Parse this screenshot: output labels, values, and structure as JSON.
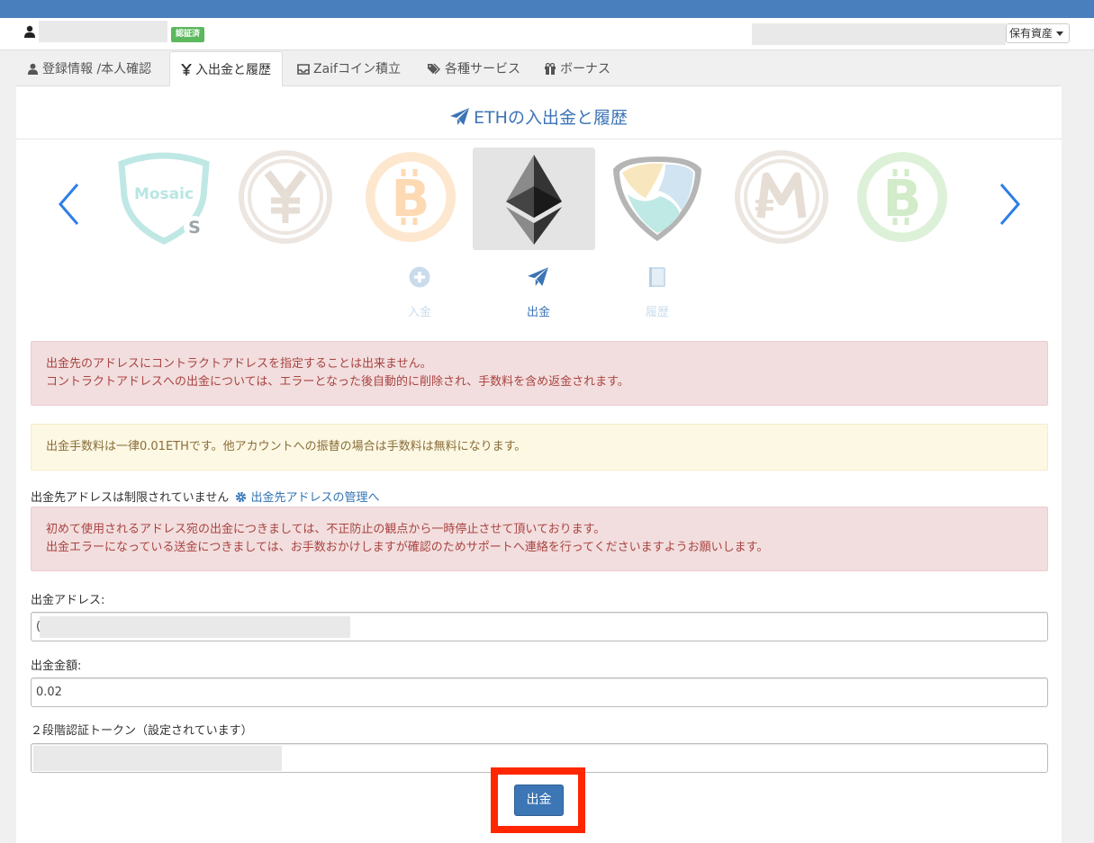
{
  "header": {
    "verified_badge": "認証済",
    "assets_button": "保有資産"
  },
  "tabs": [
    {
      "label": "登録情報 /本人確認",
      "icon": "user-icon"
    },
    {
      "label": "入出金と履歴",
      "icon": "yen-icon",
      "active": true
    },
    {
      "label": "Zaifコイン積立",
      "icon": "inbox-icon"
    },
    {
      "label": "各種サービス",
      "icon": "tags-icon"
    },
    {
      "label": "ボーナス",
      "icon": "gift-icon"
    }
  ],
  "page_title": "ETHの入出金と履歴",
  "coins": [
    "xem-mosaic",
    "jpy",
    "btc",
    "eth",
    "xem",
    "mona",
    "bch"
  ],
  "selected_coin": "eth",
  "coin_labels": {
    "mosaic": "Mosaic"
  },
  "actions": [
    {
      "label": "入金",
      "icon": "plus-circle-icon"
    },
    {
      "label": "出金",
      "icon": "paper-plane-icon",
      "active": true
    },
    {
      "label": "履歴",
      "icon": "book-icon"
    }
  ],
  "alerts": {
    "contract": {
      "line1": "出金先のアドレスにコントラクトアドレスを指定することは出来ません。",
      "line2": "コントラクトアドレスへの出金については、エラーとなった後自動的に削除され、手数料を含め返金されます。"
    },
    "fee": "出金手数料は一律0.01ETHです。他アカウントへの振替の場合は手数料は無料になります。",
    "first_time": {
      "line1": "初めて使用されるアドレス宛の出金につきましては、不正防止の観点から一時停止させて頂いております。",
      "line2": "出金エラーになっている送金につきましては、お手数おかけしますが確認のためサポートへ連絡を行ってくださいますようお願いします。"
    }
  },
  "address_restriction": {
    "text": "出金先アドレスは制限されていません",
    "link": "出金先アドレスの管理へ"
  },
  "form": {
    "address_label": "出金アドレス:",
    "address_value": "(",
    "amount_label": "出金金額:",
    "amount_value": "0.02",
    "token_label": "２段階認証トークン（設定されています）"
  },
  "submit_label": "出金",
  "colors": {
    "topbar": "#4a7fbe",
    "accent": "#3c76b5",
    "highlight": "#ff2600",
    "alert_red_bg": "#f2dede",
    "alert_yellow_bg": "#fcf8e3"
  }
}
